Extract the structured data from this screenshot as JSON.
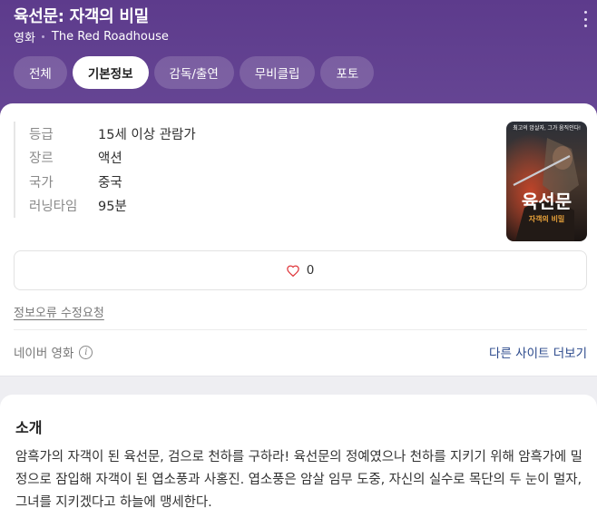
{
  "header": {
    "title": "육선문: 자객의 비밀",
    "category": "영화",
    "english_title": "The Red Roadhouse",
    "more_icon": "more-vertical-icon",
    "background_color": "#5f3f8f"
  },
  "tabs": [
    {
      "label": "전체",
      "active": false
    },
    {
      "label": "기본정보",
      "active": true
    },
    {
      "label": "감독/출연",
      "active": false
    },
    {
      "label": "무비클립",
      "active": false
    },
    {
      "label": "포토",
      "active": false
    }
  ],
  "info": [
    {
      "label": "등급",
      "value": "15세 이상 관람가"
    },
    {
      "label": "장르",
      "value": "액션"
    },
    {
      "label": "국가",
      "value": "중국"
    },
    {
      "label": "러닝타임",
      "value": "95분"
    }
  ],
  "poster": {
    "tagline": "최고의 암살자, 그가 움직인다!",
    "title": "육선문",
    "subtitle": "자객의 비밀"
  },
  "like": {
    "count": "0",
    "icon": "heart-icon",
    "icon_color": "#e0393e"
  },
  "report_link": "정보오류 수정요청",
  "source": {
    "label": "네이버 영화",
    "info_icon": "info-circle-icon",
    "more_link": "다른 사이트 더보기",
    "link_color": "#2c4a8c"
  },
  "intro": {
    "heading": "소개",
    "text": "암흑가의 자객이 된 육선문, 검으로 천하를 구하라! 육선문의 정예였으나 천하를 지키기 위해 암흑가에 밀정으로 잠입해 자객이 된 엽소풍과 사홍진. 엽소풍은 암살 임무 도중, 자신의 실수로 목단의 두 눈이 멀자, 그녀를 지키겠다고 하늘에 맹세한다."
  }
}
